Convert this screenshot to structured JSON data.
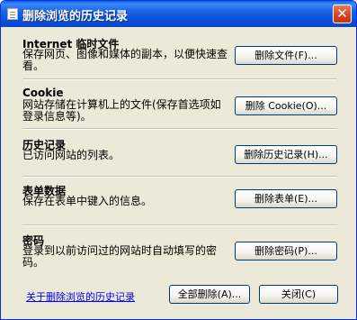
{
  "window": {
    "title": "删除浏览的历史记录",
    "close_glyph": "✕"
  },
  "sections": [
    {
      "title": "Internet 临时文件",
      "description": "保存网页、图像和媒体的副本，以便快速查看。",
      "button": "删除文件(F)..."
    },
    {
      "title": "Cookie",
      "description": "网站存储在计算机上的文件(保存首选项如登录信息等)。",
      "button": "删除 Cookie(O)..."
    },
    {
      "title": "历史记录",
      "description": "已访问网站的列表。",
      "button": "删除历史记录(H)..."
    },
    {
      "title": "表单数据",
      "description": "保存在表单中键入的信息。",
      "button": "删除表单(E)..."
    },
    {
      "title": "密码",
      "description": "登录到以前访问过的网站时自动填写的密码。",
      "button": "删除密码(P)..."
    }
  ],
  "footer": {
    "link": "关于删除浏览的历史记录",
    "delete_all_button": "全部删除(A)...",
    "close_button": "关闭(C)"
  },
  "icons": {
    "title": "window-icon",
    "close": "close-icon"
  },
  "colors": {
    "titlebar": "#0b4fd6",
    "dialog_bg": "#ece9d8",
    "close_button": "#d6421c",
    "link": "#0000ff"
  }
}
